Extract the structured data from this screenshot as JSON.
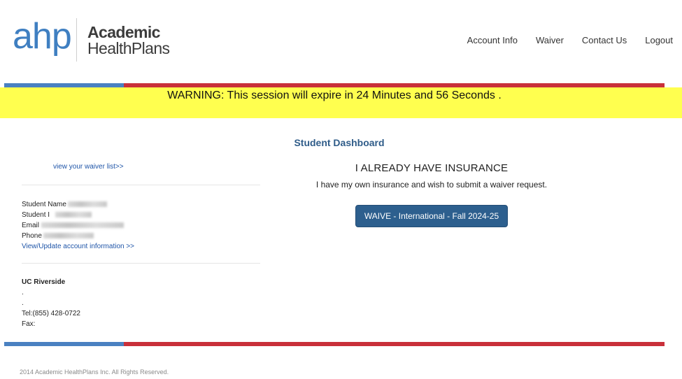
{
  "brand": {
    "logo_mark": "ahp",
    "logo_line1": "Academic",
    "logo_line2": "HealthPlans",
    "colors": {
      "blue": "#4a81c1",
      "red": "#c9303a",
      "warning_bg": "#ffff4f",
      "button": "#2d5f8e"
    }
  },
  "nav": {
    "items": [
      "Account Info",
      "Waiver",
      "Contact Us",
      "Logout"
    ]
  },
  "warning": {
    "text": "WARNING: This session will expire in 24 Minutes and 56 Seconds ."
  },
  "dashboard": {
    "title": "Student Dashboard"
  },
  "sidebar": {
    "waiver_list_link": "view your waiver list>>",
    "student_name_label": "Student Name",
    "student_id_label": "Student I",
    "email_label": "Email",
    "phone_label": "Phone",
    "account_link": "View/Update account information >>",
    "school_name": "UC Riverside",
    "address1": ".",
    "address2": ".",
    "tel": "Tel:(855) 428-0722",
    "fax": "Fax:"
  },
  "main": {
    "heading": "I ALREADY HAVE INSURANCE",
    "subtext": "I have my own insurance and wish to submit a waiver request.",
    "button_label": "WAIVE - International - Fall 2024-25"
  },
  "footer": {
    "copyright": "2014 Academic HealthPlans Inc. All Rights Reserved."
  }
}
